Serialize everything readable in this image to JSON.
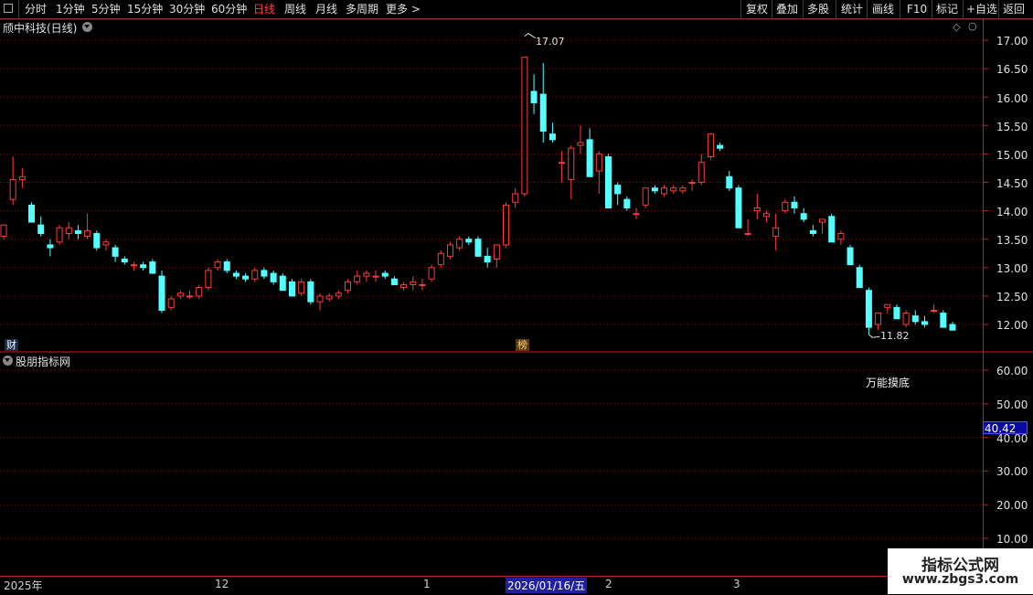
{
  "toolbar": {
    "periods": [
      "分时",
      "1分钟",
      "5分钟",
      "15分钟",
      "30分钟",
      "60分钟",
      "日线",
      "周线",
      "月线",
      "多周期",
      "更多 >"
    ],
    "active": "日线",
    "right_buttons": [
      "复权",
      "叠加",
      "多股",
      "统计",
      "画线",
      "F10",
      "标记",
      "+自选",
      "返回"
    ]
  },
  "chart": {
    "title": "颀中科技(日线)",
    "badge_cai": "财",
    "badge_bang": "榜",
    "high_label": "17.07",
    "low_label": "11.82",
    "price_axis": [
      "17.00",
      "16.50",
      "16.00",
      "15.50",
      "15.00",
      "14.50",
      "14.00",
      "13.50",
      "13.00",
      "12.50",
      "12.00"
    ]
  },
  "indicator": {
    "source": "股朋指标网",
    "name": "万能摸底",
    "axis": [
      "60.00",
      "50.00",
      "40.00",
      "30.00",
      "20.00",
      "10.00"
    ],
    "current_value": "40.42"
  },
  "date_axis": {
    "labels": [
      "2025年",
      "12",
      "1",
      "2",
      "3"
    ],
    "selected": "2026/01/16/五"
  },
  "watermark": {
    "line1": "指标公式网",
    "line2": "www.zbgs3.com"
  },
  "colors": {
    "up": "#ff3b3b",
    "down": "#54ffff",
    "grid": "#7a1010",
    "axis_border": "#c02020"
  },
  "chart_data": {
    "type": "candlestick",
    "ylim": [
      11.7,
      17.2
    ],
    "ohlc": [
      [
        13.55,
        13.75,
        13.5,
        13.75
      ],
      [
        14.2,
        14.95,
        14.1,
        14.55
      ],
      [
        14.55,
        14.75,
        14.4,
        14.6
      ],
      [
        14.1,
        14.15,
        13.8,
        13.8
      ],
      [
        13.75,
        13.9,
        13.55,
        13.6
      ],
      [
        13.4,
        13.5,
        13.2,
        13.35
      ],
      [
        13.45,
        13.75,
        13.4,
        13.7
      ],
      [
        13.6,
        13.8,
        13.5,
        13.7
      ],
      [
        13.65,
        13.75,
        13.5,
        13.6
      ],
      [
        13.55,
        13.95,
        13.5,
        13.65
      ],
      [
        13.6,
        13.65,
        13.3,
        13.35
      ],
      [
        13.4,
        13.5,
        13.3,
        13.45
      ],
      [
        13.35,
        13.4,
        13.1,
        13.2
      ],
      [
        13.15,
        13.2,
        13.05,
        13.1
      ],
      [
        13.05,
        13.1,
        12.95,
        13.05
      ],
      [
        13.05,
        13.1,
        12.95,
        13.0
      ],
      [
        13.1,
        13.15,
        12.9,
        12.9
      ],
      [
        12.85,
        12.95,
        12.2,
        12.25
      ],
      [
        12.3,
        12.5,
        12.25,
        12.45
      ],
      [
        12.5,
        12.6,
        12.45,
        12.55
      ],
      [
        12.5,
        12.6,
        12.45,
        12.5
      ],
      [
        12.5,
        12.7,
        12.45,
        12.65
      ],
      [
        12.65,
        13.0,
        12.6,
        12.95
      ],
      [
        13.0,
        13.15,
        12.95,
        13.1
      ],
      [
        13.1,
        13.15,
        12.9,
        12.95
      ],
      [
        12.9,
        12.95,
        12.8,
        12.85
      ],
      [
        12.85,
        12.9,
        12.75,
        12.8
      ],
      [
        12.8,
        13.0,
        12.75,
        12.95
      ],
      [
        12.95,
        13.0,
        12.8,
        12.85
      ],
      [
        12.9,
        12.95,
        12.7,
        12.75
      ],
      [
        12.85,
        12.9,
        12.6,
        12.6
      ],
      [
        12.75,
        12.8,
        12.5,
        12.5
      ],
      [
        12.55,
        12.8,
        12.5,
        12.75
      ],
      [
        12.75,
        12.8,
        12.35,
        12.4
      ],
      [
        12.4,
        12.55,
        12.25,
        12.5
      ],
      [
        12.45,
        12.55,
        12.4,
        12.5
      ],
      [
        12.5,
        12.6,
        12.45,
        12.55
      ],
      [
        12.6,
        12.8,
        12.55,
        12.75
      ],
      [
        12.75,
        12.95,
        12.7,
        12.85
      ],
      [
        12.85,
        12.95,
        12.75,
        12.9
      ],
      [
        12.85,
        12.95,
        12.75,
        12.85
      ],
      [
        12.9,
        12.95,
        12.8,
        12.85
      ],
      [
        12.8,
        12.85,
        12.7,
        12.7
      ],
      [
        12.65,
        12.75,
        12.6,
        12.7
      ],
      [
        12.7,
        12.85,
        12.6,
        12.75
      ],
      [
        12.7,
        12.8,
        12.6,
        12.7
      ],
      [
        12.8,
        13.05,
        12.75,
        13.0
      ],
      [
        13.05,
        13.3,
        13.0,
        13.25
      ],
      [
        13.2,
        13.45,
        13.15,
        13.4
      ],
      [
        13.35,
        13.55,
        13.3,
        13.5
      ],
      [
        13.5,
        13.55,
        13.4,
        13.45
      ],
      [
        13.5,
        13.55,
        13.3,
        13.2
      ],
      [
        13.2,
        13.35,
        13.0,
        13.1
      ],
      [
        13.15,
        13.4,
        13.0,
        13.4
      ],
      [
        13.4,
        14.15,
        13.35,
        14.1
      ],
      [
        14.15,
        14.4,
        14.05,
        14.3
      ],
      [
        14.3,
        16.7,
        14.25,
        16.7
      ],
      [
        16.1,
        16.4,
        15.7,
        15.9
      ],
      [
        16.05,
        16.6,
        15.2,
        15.4
      ],
      [
        15.35,
        15.55,
        15.2,
        15.25
      ],
      [
        14.85,
        15.05,
        14.5,
        14.85
      ],
      [
        14.55,
        15.15,
        14.2,
        15.1
      ],
      [
        15.15,
        15.5,
        15.0,
        15.2
      ],
      [
        15.25,
        15.45,
        14.6,
        14.6
      ],
      [
        14.7,
        15.05,
        14.3,
        15.0
      ],
      [
        14.95,
        15.0,
        14.2,
        14.05
      ],
      [
        14.45,
        14.5,
        14.1,
        14.3
      ],
      [
        14.2,
        14.25,
        14.0,
        14.05
      ],
      [
        13.95,
        14.05,
        13.85,
        13.95
      ],
      [
        14.1,
        14.4,
        14.05,
        14.4
      ],
      [
        14.4,
        14.45,
        14.3,
        14.35
      ],
      [
        14.3,
        14.45,
        14.25,
        14.4
      ],
      [
        14.35,
        14.45,
        14.3,
        14.4
      ],
      [
        14.35,
        14.45,
        14.3,
        14.4
      ],
      [
        14.5,
        14.55,
        14.35,
        14.5
      ],
      [
        14.5,
        15.0,
        14.45,
        14.85
      ],
      [
        14.95,
        15.35,
        14.9,
        15.35
      ],
      [
        15.15,
        15.2,
        15.05,
        15.1
      ],
      [
        14.6,
        14.7,
        14.35,
        14.4
      ],
      [
        14.4,
        14.45,
        13.7,
        13.7
      ],
      [
        13.6,
        13.85,
        13.55,
        13.6
      ],
      [
        14.0,
        14.3,
        13.85,
        14.05
      ],
      [
        13.9,
        14.0,
        13.8,
        13.95
      ],
      [
        13.55,
        13.95,
        13.3,
        13.7
      ],
      [
        14.0,
        14.2,
        13.95,
        14.15
      ],
      [
        14.15,
        14.25,
        13.95,
        14.05
      ],
      [
        13.95,
        14.05,
        13.8,
        13.85
      ],
      [
        13.65,
        13.75,
        13.55,
        13.6
      ],
      [
        13.8,
        13.85,
        13.6,
        13.85
      ],
      [
        13.9,
        13.95,
        13.45,
        13.45
      ],
      [
        13.5,
        13.65,
        13.4,
        13.6
      ],
      [
        13.35,
        13.4,
        13.05,
        13.05
      ],
      [
        13.0,
        13.05,
        12.65,
        12.65
      ],
      [
        12.6,
        12.65,
        11.82,
        11.95
      ],
      [
        12.0,
        12.2,
        11.9,
        12.2
      ],
      [
        12.3,
        12.35,
        12.2,
        12.35
      ],
      [
        12.3,
        12.35,
        12.1,
        12.1
      ],
      [
        12.0,
        12.25,
        11.95,
        12.2
      ],
      [
        12.15,
        12.25,
        12.0,
        12.05
      ],
      [
        12.05,
        12.15,
        11.95,
        12.0
      ],
      [
        12.25,
        12.35,
        12.2,
        12.25
      ],
      [
        12.2,
        12.25,
        11.95,
        11.95
      ],
      [
        12.0,
        12.05,
        11.9,
        11.9
      ]
    ]
  }
}
